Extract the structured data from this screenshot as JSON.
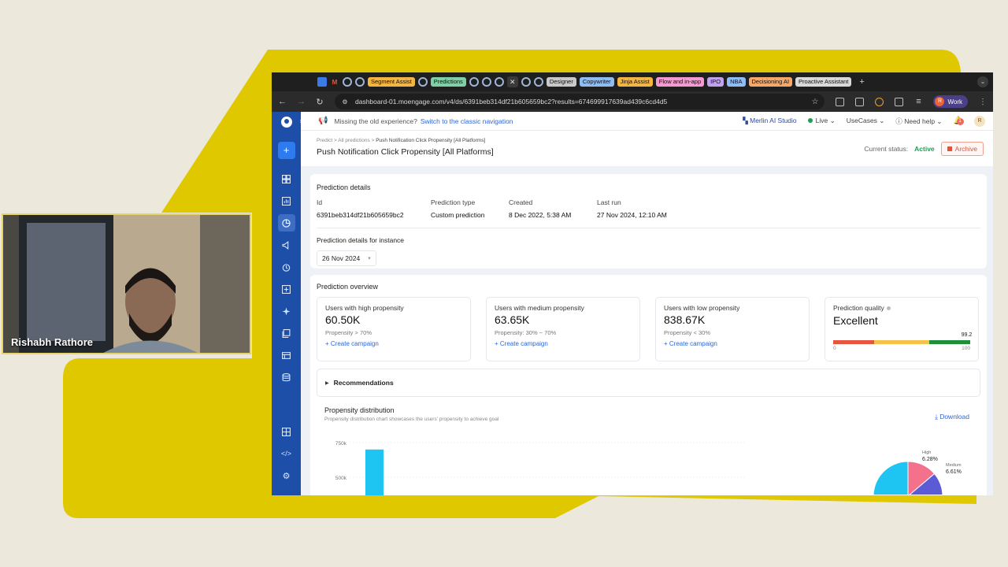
{
  "browser": {
    "tabs": [
      {
        "label": "Segment Assist",
        "color": "#f3b544"
      },
      {
        "label": "Predictions",
        "color": "#7fd0a4"
      },
      {
        "label": "Designer",
        "color": "#c9c9c9"
      },
      {
        "label": "Copywriter",
        "color": "#8fbcf3"
      },
      {
        "label": "Jinja Assist",
        "color": "#f3b544"
      },
      {
        "label": "Flow and in-app",
        "color": "#f49ad0"
      },
      {
        "label": "IPO",
        "color": "#c1a2ef"
      },
      {
        "label": "NBA",
        "color": "#8fbcf3"
      },
      {
        "label": "Decisioning AI",
        "color": "#f5a86a"
      },
      {
        "label": "Proactive Assistant",
        "color": "#d9d9d9"
      }
    ],
    "url": "dashboard-01.moengage.com/v4/ds/6391beb314df21b605659bc2?results=674699917639ad439c6cd4d5",
    "profile_label": "Work",
    "profile_initial": "R"
  },
  "topbar": {
    "notice": "Missing the old experience?",
    "notice_link": "Switch to the classic navigation",
    "merlin": "Merlin AI Studio",
    "live": "Live",
    "usecases": "UseCases",
    "help": "Need help",
    "bell_count": "1",
    "avatar": "R"
  },
  "header": {
    "breadcrumb": [
      "Predict",
      "All predictions",
      "Push Notification Click Propensity [All Platforms]"
    ],
    "title": "Push Notification Click Propensity [All Platforms]",
    "status_label": "Current status:",
    "status_value": "Active",
    "archive_label": "Archive"
  },
  "details": {
    "title": "Prediction details",
    "fields": [
      {
        "label": "Id",
        "value": "6391beb314df21b605659bc2"
      },
      {
        "label": "Prediction type",
        "value": "Custom prediction"
      },
      {
        "label": "Created",
        "value": "8 Dec 2022, 5:38 AM"
      },
      {
        "label": "Last run",
        "value": "27 Nov 2024, 12:10 AM"
      }
    ],
    "instance_label": "Prediction details for instance",
    "instance_value": "26 Nov 2024"
  },
  "overview": {
    "title": "Prediction overview",
    "kpis": [
      {
        "label": "Users with high propensity",
        "value": "60.50K",
        "sub": "Propensity > 70%",
        "link": "Create campaign"
      },
      {
        "label": "Users with medium propensity",
        "value": "63.65K",
        "sub": "Propensity: 30% ~ 70%",
        "link": "Create campaign"
      },
      {
        "label": "Users with low propensity",
        "value": "838.67K",
        "sub": "Propensity < 30%",
        "link": "Create campaign"
      }
    ],
    "quality": {
      "label": "Prediction quality",
      "value": "Excellent",
      "score": "99.2",
      "score_num": 99.2,
      "min": "0",
      "max": "100"
    },
    "recommendations": "Recommendations"
  },
  "distribution": {
    "title": "Propensity distribution",
    "subtitle": "Propensity distribution chart showcases the users' propensity to achieve goal",
    "download": "Download"
  },
  "chart_data": [
    {
      "type": "bar",
      "title": "",
      "yticks": [
        "750k",
        "500k"
      ],
      "ylim": [
        0,
        750000
      ],
      "values": [
        700000
      ]
    },
    {
      "type": "pie",
      "labels": [
        "High",
        "Medium"
      ],
      "values_text": [
        "6.28%",
        "6.61%"
      ],
      "values": [
        6.28,
        6.61
      ]
    }
  ],
  "webcam": {
    "name": "Rishabh Rathore"
  }
}
